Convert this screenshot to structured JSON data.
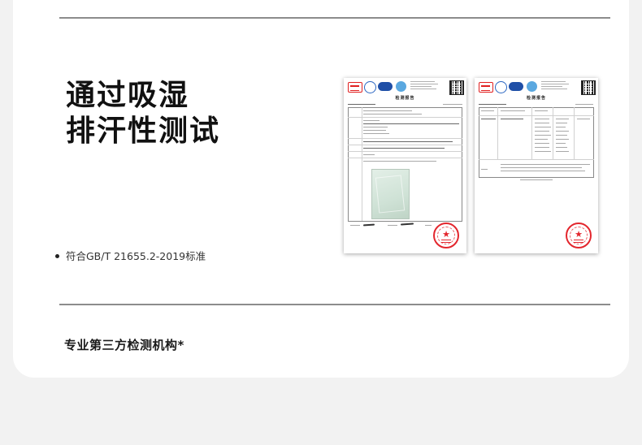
{
  "headline": {
    "line1": "通过吸湿",
    "line2": "排汗性测试"
  },
  "bullet": {
    "text": "符合GB/T 21655.2-2019标准"
  },
  "footnote": {
    "text": "专业第三方检测机构*"
  },
  "reports": [
    {
      "title": "检测报告"
    },
    {
      "title": "检测报告"
    }
  ],
  "colors": {
    "stamp": "#e3262d",
    "rule": "#8c8c8c",
    "cnas": "#1f4fa7"
  },
  "icons": [
    "cma-logo-icon",
    "cnas-logo-icon",
    "ilac-logo-icon",
    "qr-code-icon",
    "official-seal-icon"
  ]
}
